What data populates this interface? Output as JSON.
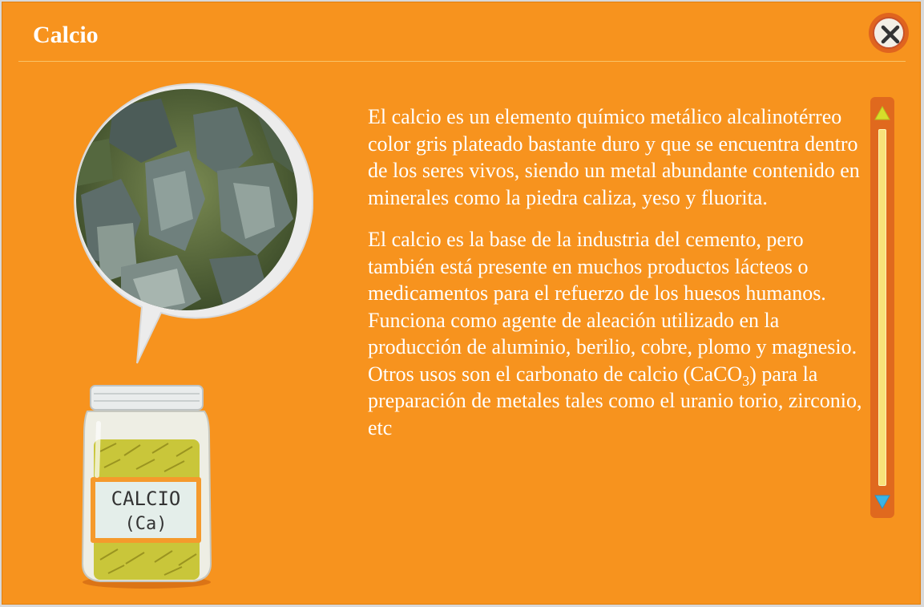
{
  "dialog": {
    "title": "Calcio",
    "close_icon": "close-icon"
  },
  "illustration": {
    "jar_label_line1": "CALCIO",
    "jar_label_line2": "(Ca)"
  },
  "content": {
    "paragraph1": "El calcio es un elemento químico metálico alcalinotérreo color gris plateado bastante duro y que se encuentra dentro de los seres vivos, siendo un metal abundante contenido en minerales como la piedra caliza, yeso y fluorita.",
    "paragraph2_part1": "El calcio es la base de la industria del cemento, pero también está presente en muchos productos lácteos o medicamentos para el refuerzo de los huesos humanos. Funciona como agente de aleación utilizado en la producción de aluminio, berilio, cobre, plomo y magnesio. Otros usos son el carbonato de calcio (CaCO",
    "paragraph2_sub": "3",
    "paragraph2_part2": ") para la preparación de metales tales como el uranio torio, zirconio, etc"
  },
  "scrollbar": {
    "up_icon": "arrow-up-icon",
    "down_icon": "arrow-down-icon"
  },
  "colors": {
    "background": "#f7931e",
    "text": "#ffffff",
    "scrollbar": "#e0691e",
    "track": "#f8e27a",
    "arrow_up": "#d6de2a",
    "arrow_down": "#3ab4e6"
  }
}
